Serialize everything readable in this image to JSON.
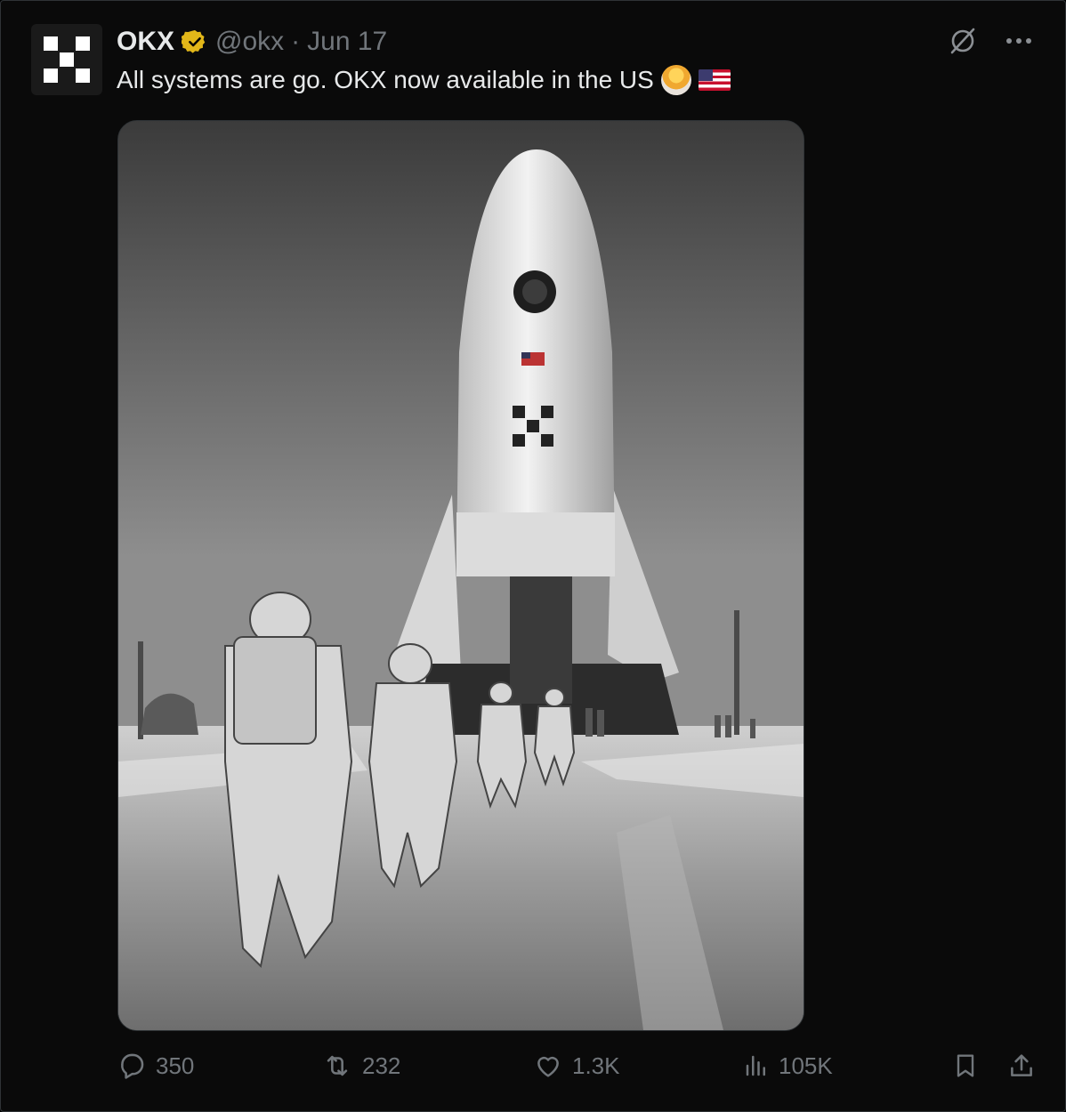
{
  "account": {
    "name": "OKX",
    "handle": "@okx",
    "separator": "·",
    "date": "Jun 17"
  },
  "tweet": {
    "text": "All systems are go. OKX now available in the US",
    "emojis": [
      "astronaut",
      "flag-us"
    ]
  },
  "media": {
    "alt": ""
  },
  "metrics": {
    "replies": "350",
    "reposts": "232",
    "likes": "1.3K",
    "views": "105K"
  },
  "icons": {
    "verified": "verified-badge-icon",
    "grok": "grok-icon",
    "more": "more-icon",
    "reply": "reply-icon",
    "repost": "repost-icon",
    "like": "like-icon",
    "views": "views-icon",
    "bookmark": "bookmark-icon",
    "share": "share-icon"
  },
  "colors": {
    "background": "#000000",
    "text": "#e7e9ea",
    "muted": "#71767b",
    "verified": "#e2b719"
  }
}
